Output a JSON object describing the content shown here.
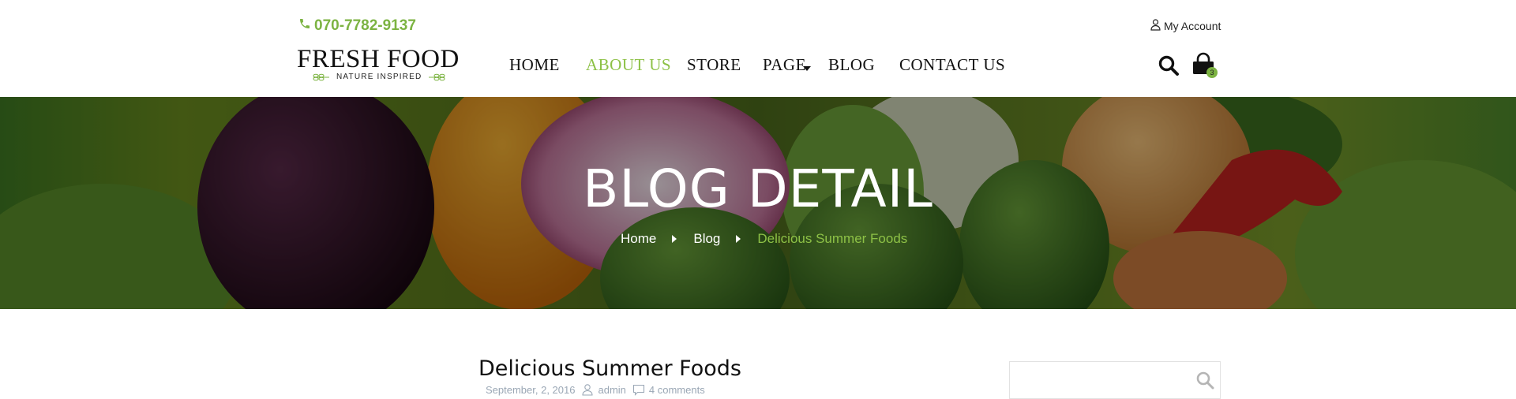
{
  "header": {
    "phone": "070-7782-9137",
    "account_label": "My Account",
    "logo": {
      "title": "FRESH FOOD",
      "tagline": "NATURE INSPIRED"
    },
    "nav": [
      {
        "label": "HOME"
      },
      {
        "label": "ABOUT US",
        "active": true
      },
      {
        "label": "STORE"
      },
      {
        "label": "PAGE",
        "has_dropdown": true
      },
      {
        "label": "BLOG"
      },
      {
        "label": "CONTACT US"
      }
    ],
    "cart_count": "3",
    "icons": {
      "phone": "phone-icon",
      "account": "user-icon",
      "search": "search-icon",
      "cart": "shopping-bag-icon"
    }
  },
  "banner": {
    "title": "BLOG DETAIL",
    "breadcrumb": [
      {
        "label": "Home"
      },
      {
        "label": "Blog"
      },
      {
        "label": "Delicious Summer Foods",
        "current": true
      }
    ]
  },
  "post": {
    "title": "Delicious Summer Foods",
    "date": "September, 2, 2016",
    "author": "admin",
    "comments": "4 comments"
  },
  "sidebar": {
    "search_value": "",
    "search_placeholder": ""
  },
  "colors": {
    "accent": "#8dc146",
    "text": "#111111",
    "meta": "#9aa7b5"
  }
}
